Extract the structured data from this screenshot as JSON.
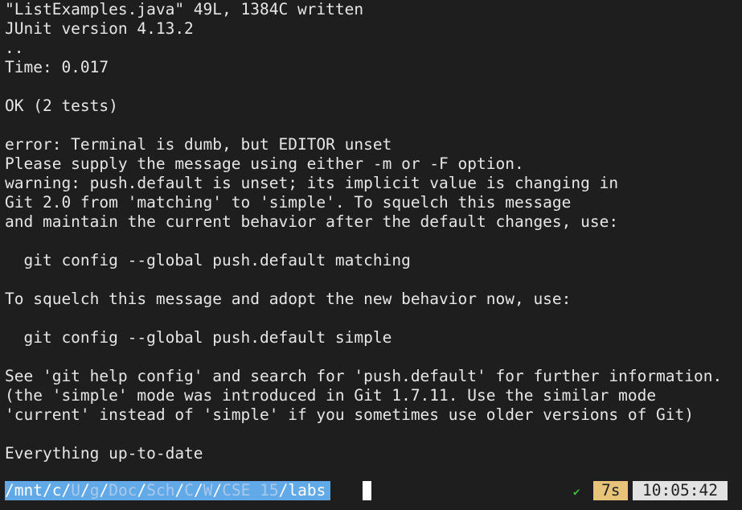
{
  "output_lines": [
    "\"ListExamples.java\" 49L, 1384C written",
    "JUnit version 4.13.2",
    "..",
    "Time: 0.017",
    "",
    "OK (2 tests)",
    "",
    "error: Terminal is dumb, but EDITOR unset",
    "Please supply the message using either -m or -F option.",
    "warning: push.default is unset; its implicit value is changing in",
    "Git 2.0 from 'matching' to 'simple'. To squelch this message",
    "and maintain the current behavior after the default changes, use:",
    "",
    "  git config --global push.default matching",
    "",
    "To squelch this message and adopt the new behavior now, use:",
    "",
    "  git config --global push.default simple",
    "",
    "See 'git help config' and search for 'push.default' for further information.",
    "(the 'simple' mode was introduced in Git 1.7.11. Use the similar mode",
    "'current' instead of 'simple' if you sometimes use older versions of Git)",
    "",
    "Everything up-to-date"
  ],
  "prompt": {
    "path_segments": [
      "mnt",
      "c",
      "U",
      "g",
      "Doc",
      "Sch",
      "C",
      "W",
      "CSE 15",
      "labs"
    ],
    "status_icon": "check-icon",
    "status_glyph": "✔",
    "duration": "7s",
    "time": "10:05:42",
    "colors": {
      "path_bg": "#62a9e8",
      "duration_bg": "#e8c47a",
      "time_bg": "#e2e2e2",
      "ok": "#3fbf3f"
    }
  }
}
